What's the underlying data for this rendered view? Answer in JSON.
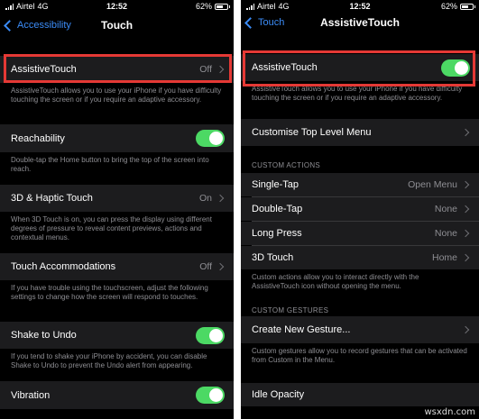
{
  "left": {
    "status": {
      "carrier": "Airtel",
      "network": "4G",
      "time": "12:52",
      "battery": "62%"
    },
    "back_label": "Accessibility",
    "title": "Touch",
    "rows": {
      "assistivetouch": {
        "label": "AssistiveTouch",
        "value": "Off"
      },
      "assistivetouch_desc": "AssistiveTouch allows you to use your iPhone if you have difficulty touching the screen or if you require an adaptive accessory.",
      "reachability": {
        "label": "Reachability",
        "on": true
      },
      "reachability_desc": "Double-tap the Home button to bring the top of the screen into reach.",
      "haptic": {
        "label": "3D & Haptic Touch",
        "value": "On"
      },
      "haptic_desc": "When 3D Touch is on, you can press the display using different degrees of pressure to reveal content previews, actions and contextual menus.",
      "accommodations": {
        "label": "Touch Accommodations",
        "value": "Off"
      },
      "accommodations_desc": "If you have trouble using the touchscreen, adjust the following settings to change how the screen will respond to touches.",
      "shake": {
        "label": "Shake to Undo",
        "on": true
      },
      "shake_desc": "If you tend to shake your iPhone by accident, you can disable Shake to Undo to prevent the Undo alert from appearing.",
      "vibration": {
        "label": "Vibration",
        "on": true
      }
    }
  },
  "right": {
    "status": {
      "carrier": "Airtel",
      "network": "4G",
      "time": "12:52",
      "battery": "62%"
    },
    "back_label": "Touch",
    "title": "AssistiveTouch",
    "rows": {
      "assistivetouch": {
        "label": "AssistiveTouch",
        "on": true
      },
      "assistivetouch_desc": "AssistiveTouch allows you to use your iPhone if you have difficulty touching the screen or if you require an adaptive accessory.",
      "customise": {
        "label": "Customise Top Level Menu"
      },
      "custom_actions_header": "CUSTOM ACTIONS",
      "single_tap": {
        "label": "Single-Tap",
        "value": "Open Menu"
      },
      "double_tap": {
        "label": "Double-Tap",
        "value": "None"
      },
      "long_press": {
        "label": "Long Press",
        "value": "None"
      },
      "touch_3d": {
        "label": "3D Touch",
        "value": "Home"
      },
      "custom_actions_desc": "Custom actions allow you to interact directly with the AssistiveTouch icon without opening the menu.",
      "custom_gestures_header": "CUSTOM GESTURES",
      "new_gesture": {
        "label": "Create New Gesture..."
      },
      "custom_gestures_desc": "Custom gestures allow you to record gestures that can be activated from Custom in the Menu.",
      "idle_opacity": {
        "label": "Idle Opacity"
      }
    }
  },
  "watermark": "wsxdn.com",
  "colors": {
    "accent": "#3b8cf7",
    "toggle_on": "#4cd964",
    "highlight": "#e53935",
    "cell_bg": "#1c1c1e"
  }
}
